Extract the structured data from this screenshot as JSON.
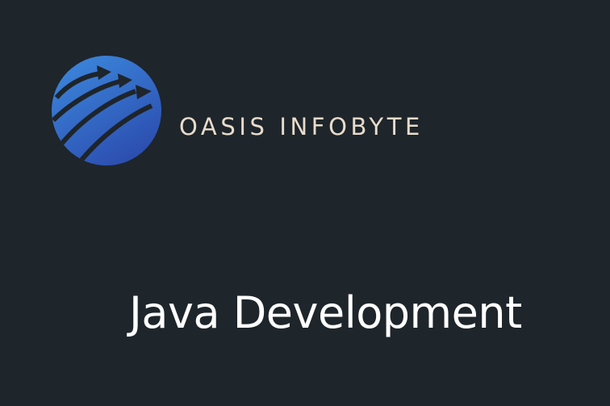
{
  "brand": {
    "name": "OASIS INFOBYTE",
    "logo_icon": "rising-arrows-globe-icon",
    "logo_colors": [
      "#3d8be0",
      "#2c4fb0"
    ]
  },
  "headline": {
    "text": "Java Development"
  },
  "colors": {
    "background": "#1e252b",
    "brand_text": "#e8dccb",
    "headline_text": "#ffffff"
  }
}
